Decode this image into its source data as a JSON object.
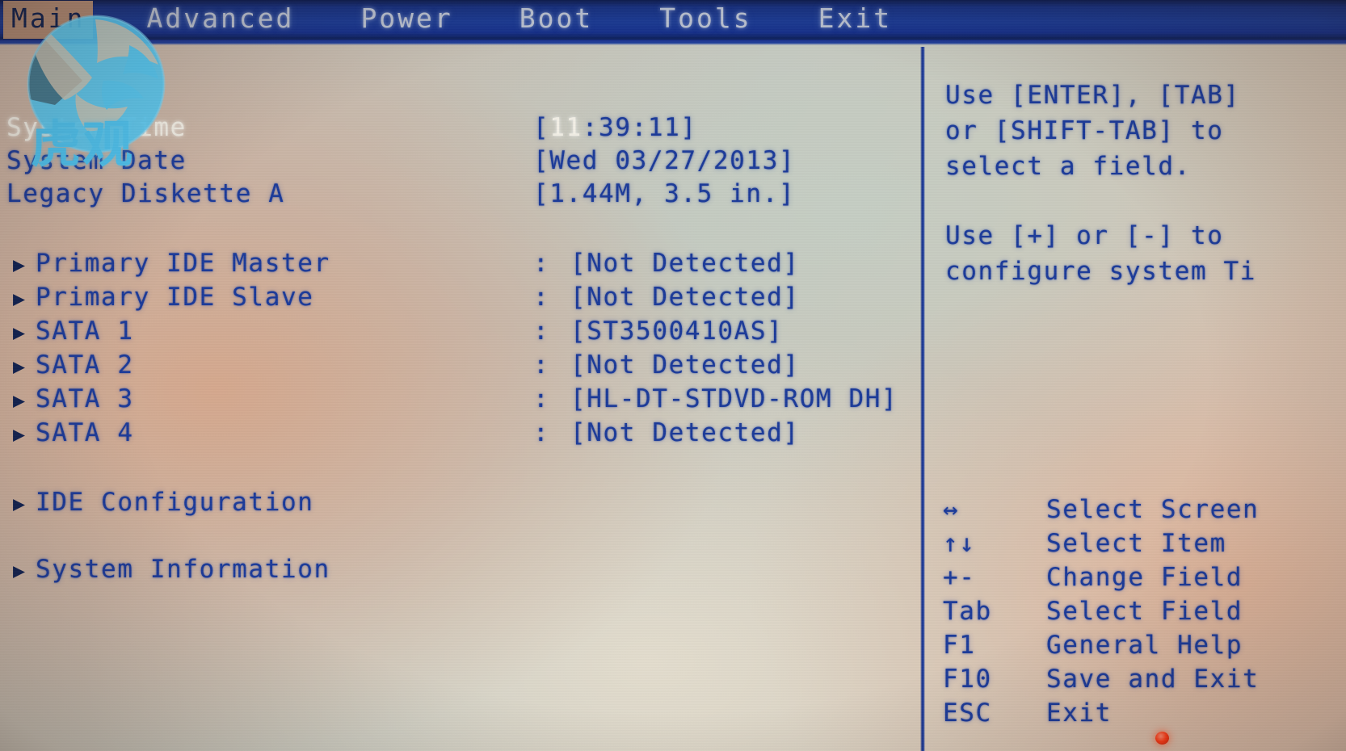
{
  "menu": {
    "tabs": [
      {
        "label": "Main",
        "active": true
      },
      {
        "label": "Advanced",
        "active": false
      },
      {
        "label": "Power",
        "active": false
      },
      {
        "label": "Boot",
        "active": false
      },
      {
        "label": "Tools",
        "active": false
      },
      {
        "label": "Exit",
        "active": false
      }
    ]
  },
  "watermark": {
    "text": "虎观",
    "logo_icon": "tiger-circle-logo-icon",
    "color": "#4ec3f0"
  },
  "main": {
    "system_time": {
      "label": "System Time",
      "value_open": "[",
      "value_hour": "11",
      "value_rest": ":39:11]"
    },
    "system_date": {
      "label": "System Date",
      "value": "[Wed 03/27/2013]"
    },
    "legacy_diskette": {
      "label": "Legacy Diskette A",
      "value": "[1.44M, 3.5 in.]"
    },
    "drives": [
      {
        "label": "Primary IDE Master",
        "sep": ":",
        "value": "[Not Detected]"
      },
      {
        "label": "Primary IDE Slave",
        "sep": ":",
        "value": "[Not Detected]"
      },
      {
        "label": "SATA 1",
        "sep": ":",
        "value": "[ST3500410AS]"
      },
      {
        "label": "SATA 2",
        "sep": ":",
        "value": "[Not Detected]"
      },
      {
        "label": "SATA 3",
        "sep": ":",
        "value": "[HL-DT-STDVD-ROM DH]"
      },
      {
        "label": "SATA 4",
        "sep": ":",
        "value": "[Not Detected]"
      }
    ],
    "submenus": [
      {
        "label": "IDE Configuration"
      },
      {
        "label": "System Information"
      }
    ],
    "arrow_glyph": "▶"
  },
  "help": {
    "lines": [
      "Use [ENTER], [TAB]",
      "or [SHIFT-TAB] to",
      "select a field.",
      "",
      "Use [+] or [-] to",
      "configure system Ti"
    ]
  },
  "keys": [
    {
      "key": "↔",
      "action": "Select Screen"
    },
    {
      "key": "↑↓",
      "action": "Select Item"
    },
    {
      "key": "+-",
      "action": "Change Field"
    },
    {
      "key": "Tab",
      "action": "Select Field"
    },
    {
      "key": "F1",
      "action": "General Help"
    },
    {
      "key": "F10",
      "action": "Save and Exit"
    },
    {
      "key": "ESC",
      "action": "Exit"
    }
  ],
  "colors": {
    "text_blue": "#1b3a99",
    "menu_blue": "#1b3a92",
    "active_tab_bg": "#b08a74",
    "highlight": "#f2efe6",
    "led_red": "#ff3b16"
  }
}
